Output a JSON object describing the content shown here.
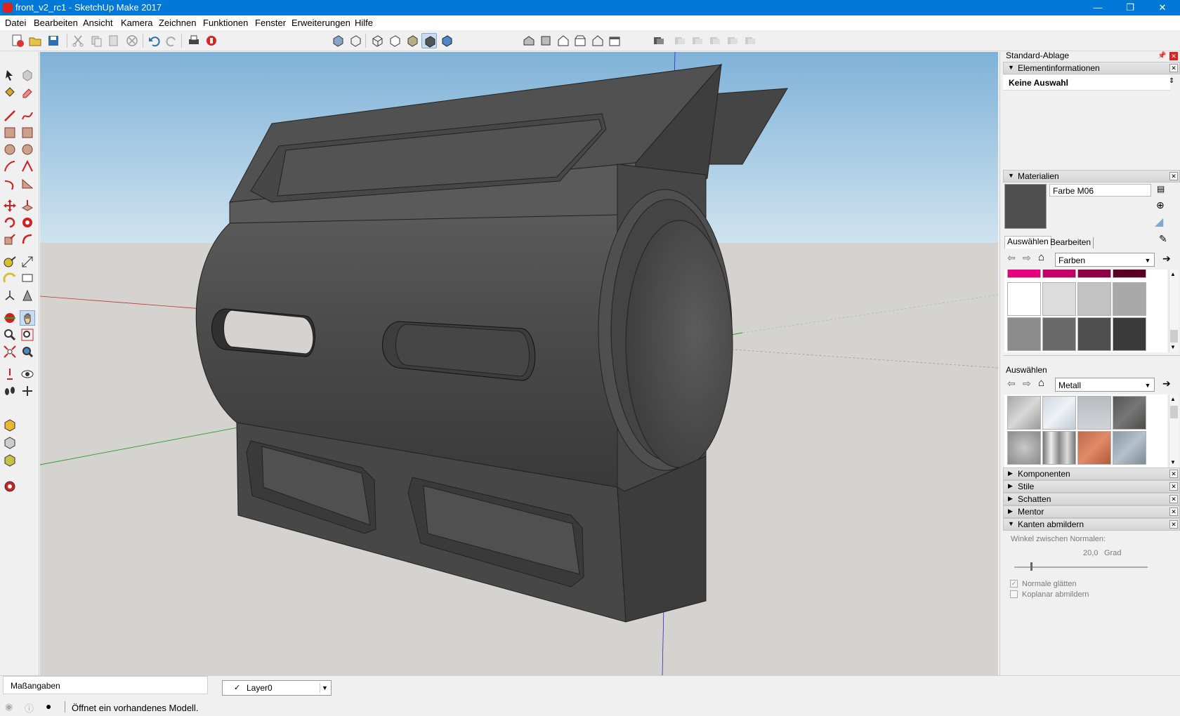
{
  "window": {
    "title": "front_v2_rc1 - SketchUp Make 2017",
    "minimize": "—",
    "restore": "❐",
    "close": "✕"
  },
  "menu": [
    "Datei",
    "Bearbeiten",
    "Ansicht",
    "Kamera",
    "Zeichnen",
    "Funktionen",
    "Fenster",
    "Erweiterungen",
    "Hilfe"
  ],
  "tray": {
    "title": "Standard-Ablage",
    "entity_info": {
      "label": "Elementinformationen",
      "selection": "Keine Auswahl"
    },
    "materials": {
      "label": "Materialien",
      "current_name": "Farbe M06",
      "current_color": "#4f4f4f",
      "tab_select": "Auswählen",
      "tab_edit": "Bearbeiten",
      "library_top": "Farben",
      "secondary_label": "Auswählen",
      "library_bottom": "Metall",
      "colors_partial": [
        "#e6007e",
        "#c4006a",
        "#8e0045",
        "#5a0022"
      ],
      "colors_row1": [
        "#ffffff",
        "#dcdcdc",
        "#c2c2c2",
        "#a9a9a9"
      ],
      "colors_row2": [
        "#8c8c8c",
        "#6a6a6a",
        "#4f4f4f",
        "#3a3a3a"
      ],
      "colors_partial2": [
        "#151515",
        "#000000"
      ]
    },
    "collapsed_panels": [
      "Komponenten",
      "Stile",
      "Schatten",
      "Mentor"
    ],
    "soften": {
      "label": "Kanten abmildern",
      "angle_label": "Winkel zwischen Normalen:",
      "angle_value": "20,0",
      "angle_unit": "Grad",
      "angle_fraction": 0.12,
      "smooth_normals": "Normale glätten",
      "soften_coplanar": "Koplanar abmildern"
    }
  },
  "status": {
    "measurements_label": "Maßangaben",
    "layer": "Layer0",
    "message": "Öffnet ein vorhandenes Modell."
  },
  "colors": {
    "accent": "#0078d7",
    "sky": "#a3cbe6",
    "ground": "#d4d3cf",
    "model": "#4a4a4a"
  }
}
